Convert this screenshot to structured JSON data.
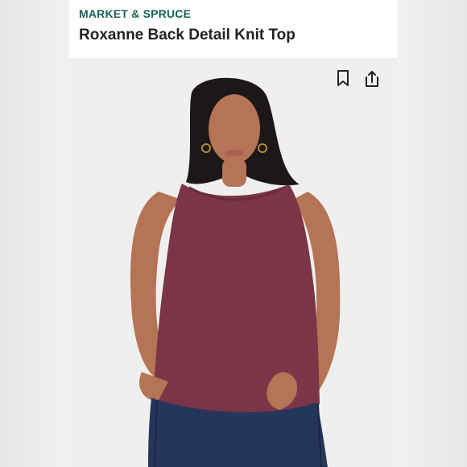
{
  "listing": {
    "brand": "MARKET & SPRUCE",
    "title": "Roxanne Back Detail Knit Top"
  },
  "icons": {
    "bookmark": "bookmark-icon",
    "share": "share-icon"
  },
  "colors": {
    "brand": "#17605a",
    "top": "#7a3547",
    "jeans": "#25365b"
  }
}
